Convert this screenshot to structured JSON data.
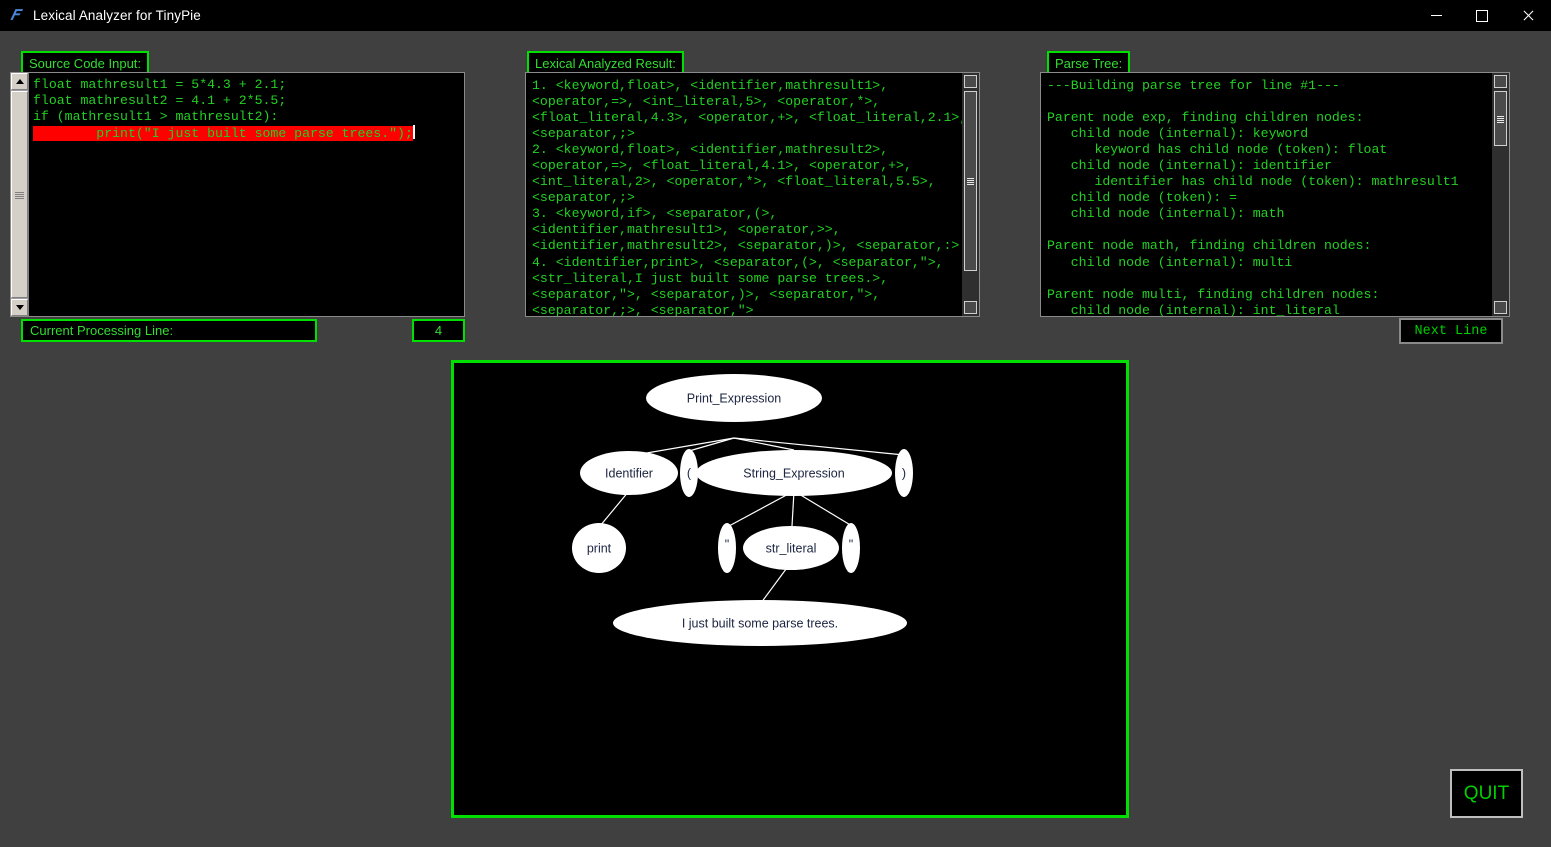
{
  "window": {
    "title": "Lexical Analyzer for TinyPie",
    "icon": "app-icon",
    "controls": {
      "minimize": "—",
      "maximize": "□",
      "close": "✕"
    }
  },
  "source_panel": {
    "label": "Source Code Input:",
    "lines": [
      "float mathresult1 = 5*4.3 + 2.1;",
      "float mathresult2 = 4.1 + 2*5.5;",
      "if (mathresult1 > mathresult2):"
    ],
    "highlighted_line": "        print(\"I just built some parse trees.\");",
    "highlight_bg": "#ff0000",
    "text_color": "#23d023"
  },
  "lexical_panel": {
    "label": "Lexical Analyzed Result:",
    "text": "1. <keyword,float>, <identifier,mathresult1>,\n<operator,=>, <int_literal,5>, <operator,*>,\n<float_literal,4.3>, <operator,+>, <float_literal,2.1>,\n<separator,;>\n2. <keyword,float>, <identifier,mathresult2>,\n<operator,=>, <float_literal,4.1>, <operator,+>,\n<int_literal,2>, <operator,*>, <float_literal,5.5>,\n<separator,;>\n3. <keyword,if>, <separator,(>,\n<identifier,mathresult1>, <operator,>>,\n<identifier,mathresult2>, <separator,)>, <separator,:>\n4. <identifier,print>, <separator,(>, <separator,\">,\n<str_literal,I just built some parse trees.>,\n<separator,\">, <separator,)>, <separator,\">,\n<separator,;>, <separator,\">"
  },
  "parse_tree_panel": {
    "label": "Parse Tree:",
    "text": "---Building parse tree for line #1---\n\nParent node exp, finding children nodes:\n   child node (internal): keyword\n      keyword has child node (token): float\n   child node (internal): identifier\n      identifier has child node (token): mathresult1\n   child node (token): =\n   child node (internal): math\n\nParent node math, finding children nodes:\n   child node (internal): multi\n\nParent node multi, finding children nodes:\n   child node (internal): int_literal"
  },
  "status_bar": {
    "current_line_label": "Current Processing Line:",
    "current_line_value": "4",
    "next_line_button": "Next  Line"
  },
  "quit_button": {
    "label": "QUIT"
  },
  "tree_graph": {
    "root": "Print_Expression",
    "nodes": [
      {
        "id": "print_expression",
        "label": "Print_Expression"
      },
      {
        "id": "identifier",
        "label": "Identifier"
      },
      {
        "id": "lparen",
        "label": "("
      },
      {
        "id": "string_expression",
        "label": "String_Expression"
      },
      {
        "id": "rparen",
        "label": ")"
      },
      {
        "id": "print",
        "label": "print"
      },
      {
        "id": "quote_open",
        "label": "\""
      },
      {
        "id": "str_literal",
        "label": "str_literal"
      },
      {
        "id": "quote_close",
        "label": "\""
      },
      {
        "id": "string_value",
        "label": "I just built some parse trees."
      }
    ],
    "edges": [
      [
        "print_expression",
        "identifier"
      ],
      [
        "print_expression",
        "lparen"
      ],
      [
        "print_expression",
        "string_expression"
      ],
      [
        "print_expression",
        "rparen"
      ],
      [
        "identifier",
        "print"
      ],
      [
        "string_expression",
        "quote_open"
      ],
      [
        "string_expression",
        "str_literal"
      ],
      [
        "string_expression",
        "quote_close"
      ],
      [
        "str_literal",
        "string_value"
      ]
    ],
    "node_fill": "#ffffff",
    "edge_color": "#ffffff",
    "canvas_bg": "#000000",
    "canvas_border": "#00e000"
  },
  "colors": {
    "app_background": "#404040",
    "terminal_green": "#23d023",
    "accent_green": "#00e000",
    "panel_background": "#000000"
  }
}
